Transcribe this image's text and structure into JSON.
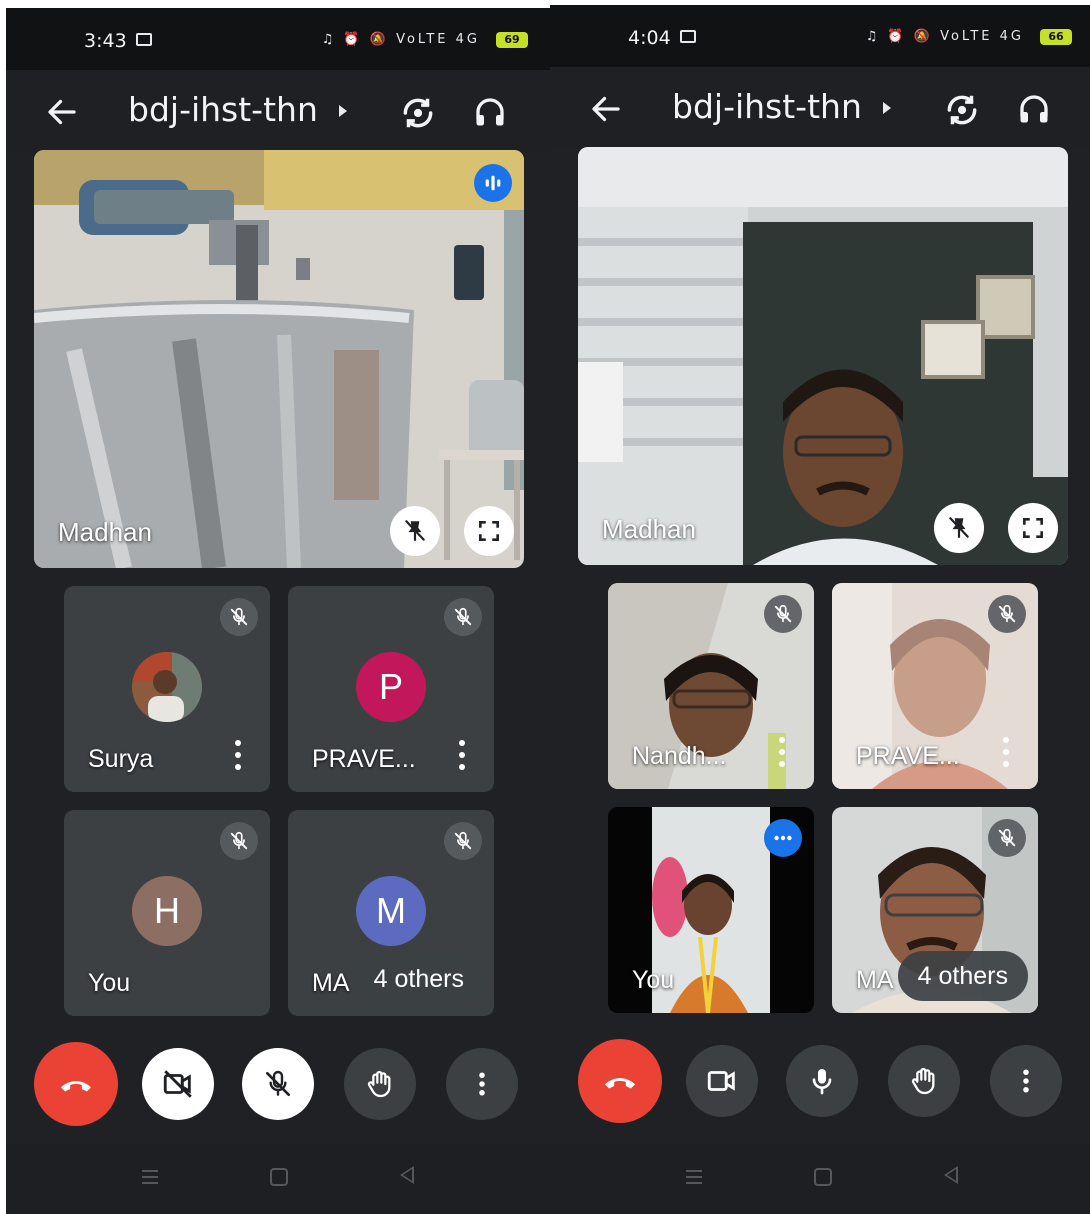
{
  "left": {
    "status": {
      "time": "3:43",
      "indicators": "♫ ⏰ 🔕 VoLTE 4G",
      "battery": "69"
    },
    "meeting": {
      "title": "bdj-ihst-thn"
    },
    "main": {
      "name": "Madhan",
      "video": "kitchen-mixer-machine"
    },
    "tiles": [
      {
        "name": "Surya",
        "avatar": "photo",
        "muted": true
      },
      {
        "name": "PRAVE...",
        "avatar_letter": "P",
        "avatar_color": "#c2185b",
        "muted": true
      },
      {
        "name": "You",
        "avatar_letter": "H",
        "avatar_color": "#8d6e63",
        "muted": true
      },
      {
        "name": "MA",
        "avatar_letter": "M",
        "avatar_color": "#5c6bc0",
        "muted": true,
        "others": "4 others"
      }
    ],
    "controls": {
      "camera": "off",
      "mic": "off"
    }
  },
  "right": {
    "status": {
      "time": "4:04",
      "indicators": "♫ ⏰ 🔕 VoLTE 4G",
      "battery": "66"
    },
    "meeting": {
      "title": "bdj-ihst-thn"
    },
    "main": {
      "name": "Madhan",
      "video": "man-in-office"
    },
    "tiles": [
      {
        "name": "Nandh...",
        "muted": true,
        "video": "woman-with-glasses"
      },
      {
        "name": "PRAVE...",
        "muted": true,
        "video": "woman-bright"
      },
      {
        "name": "You",
        "muted": false,
        "video": "self-woman"
      },
      {
        "name": "MA",
        "muted": true,
        "video": "man-with-glasses",
        "others": "4 others"
      }
    ],
    "controls": {
      "camera": "on",
      "mic": "on"
    }
  },
  "icons": {
    "back": "arrow-left-icon",
    "flip": "camera-flip-icon",
    "audio": "headphones-icon",
    "pin": "pin-off-icon",
    "expand": "fullscreen-icon",
    "speaking": "audio-level-icon",
    "muted": "mic-off-icon",
    "more": "more-vert-icon",
    "end": "call-end-icon",
    "camera": "video-icon",
    "mic": "mic-icon",
    "hand": "raise-hand-icon"
  },
  "colors": {
    "background": "#202124",
    "end_call": "#ea4335",
    "speaking": "#1a73e8",
    "tile": "#3c4043"
  }
}
